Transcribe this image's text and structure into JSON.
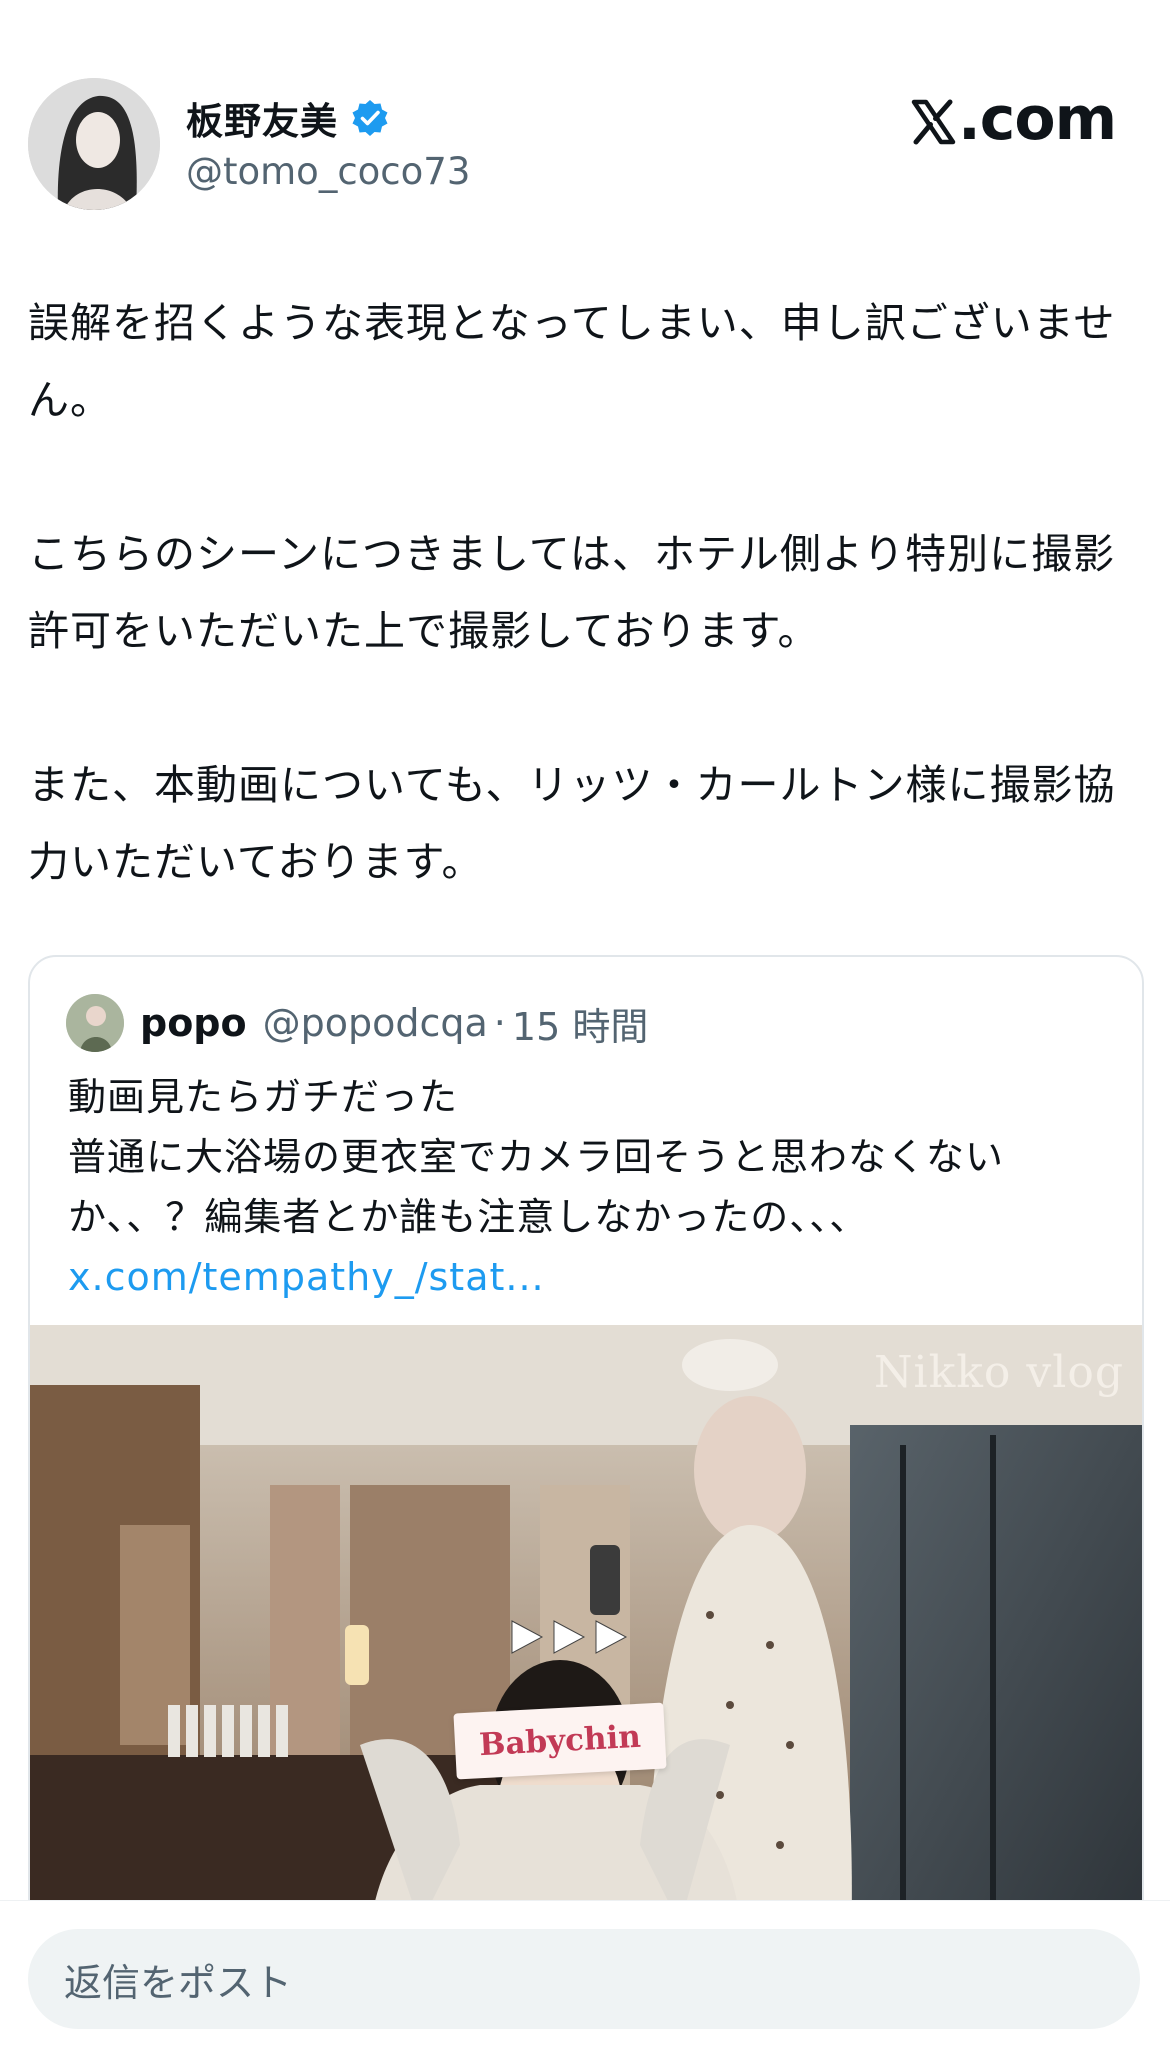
{
  "author": {
    "display_name": "板野友美",
    "handle": "@tomo_coco73",
    "verified_icon": "verified-badge-icon"
  },
  "brand": {
    "label": ".com",
    "logo_icon": "x-logo-icon"
  },
  "tweet": {
    "paragraphs": [
      "誤解を招くような表現となってしまい、申し訳ございません。",
      "こちらのシーンにつきましては、ホテル側より特別に撮影許可をいただいた上で撮影しております。",
      "また、本動画についても、リッツ・カールトン様に撮影協力いただいております。"
    ]
  },
  "quote": {
    "display_name": "popo",
    "handle": "@popodcqa",
    "separator": "·",
    "time": "15 時間",
    "lines": [
      "動画見たらガチだった",
      "普通に大浴場の更衣室でカメラ回そうと思わなくないか、、？編集者とか誰も注意しなかったの、、、"
    ],
    "link": "x.com/tempathy_/stat...",
    "media": {
      "overlay_title": "Nikko vlog",
      "sticker_text": "Babychin",
      "play_icon": "play-triple-arrow-icon"
    }
  },
  "reply": {
    "placeholder": "返信をポスト"
  },
  "colors": {
    "accent": "#1d9bf0",
    "text": "#0f1419",
    "muted": "#536471",
    "input_bg": "#eff3f4"
  }
}
